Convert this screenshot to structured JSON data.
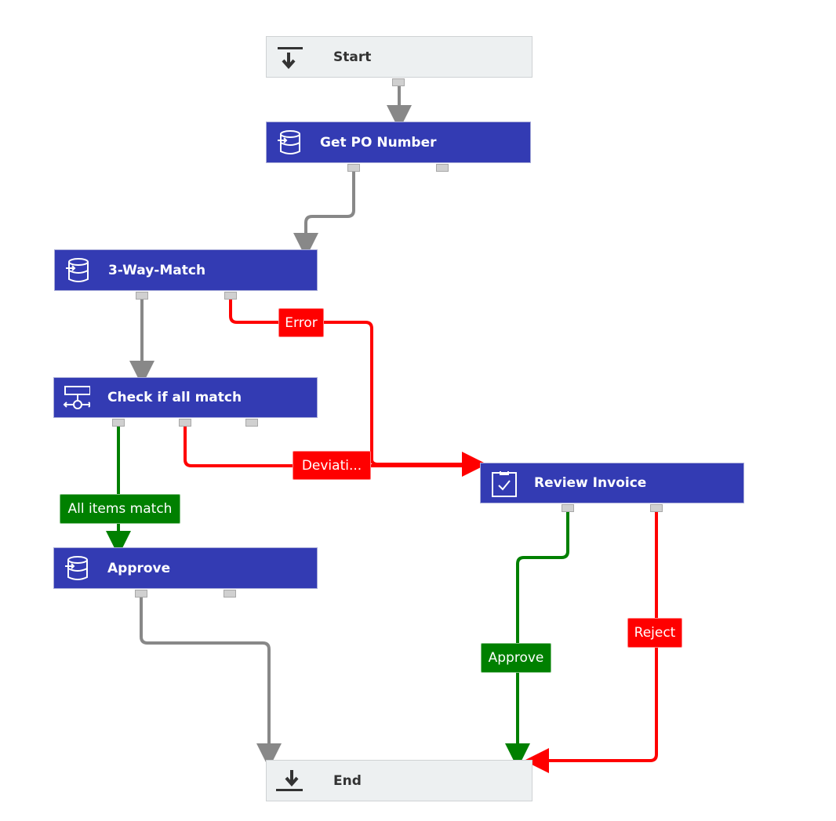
{
  "colors": {
    "node": "#333bb3",
    "terminal": "#edf0f1",
    "default": "#888888",
    "error": "#ff0000",
    "success": "#008000"
  },
  "nodes": {
    "start": {
      "label": "Start",
      "icon": "start-arrow-icon"
    },
    "get_po": {
      "label": "Get PO Number",
      "icon": "database-icon"
    },
    "three_way": {
      "label": "3-Way-Match",
      "icon": "database-icon"
    },
    "check": {
      "label": "Check if all match",
      "icon": "decision-icon"
    },
    "approve": {
      "label": "Approve",
      "icon": "database-icon"
    },
    "review": {
      "label": "Review Invoice",
      "icon": "task-check-icon"
    },
    "end": {
      "label": "End",
      "icon": "end-arrow-icon"
    }
  },
  "edges": {
    "error": "Error",
    "deviation": "Deviati...",
    "all_match": "All items match",
    "review_approve": "Approve",
    "review_reject": "Reject"
  }
}
